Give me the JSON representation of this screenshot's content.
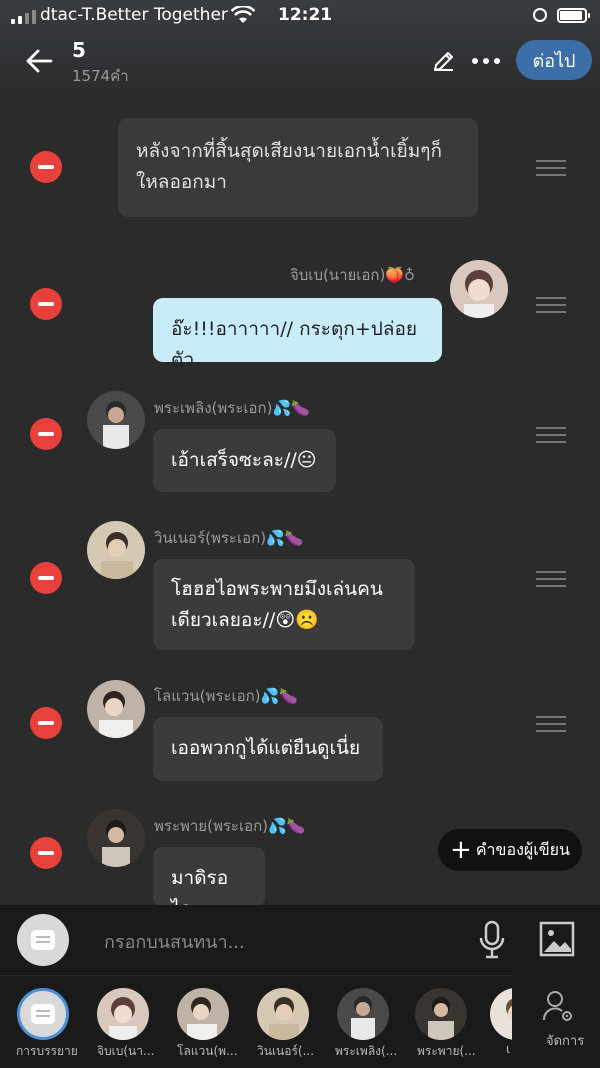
{
  "status_bar": {
    "carrier": "dtac-T.Better Together",
    "time": "12:21"
  },
  "header": {
    "title": "5",
    "subtitle": "1574คำ",
    "next_label": "ต่อไป"
  },
  "messages": [
    {
      "type": "narration",
      "line1": "หลังจากที่สิ้นสุดเสียงนายเอกน้ำเยิ้มๆก็",
      "line2": "ใหลออกมา"
    },
    {
      "type": "me",
      "speaker": "จิบเบ(นายเอก)🍑♁",
      "text": "อ๊ะ!!!อาาาาา// กระตุก+ปล่อยตัว"
    },
    {
      "type": "other",
      "speaker": "พระเพลิง(พระเอก)💦🍆",
      "text": "เอ้าเสร็จซะละ//😐"
    },
    {
      "type": "other",
      "speaker": "วินเนอร์(พระเอก)💦🍆",
      "line1": "โฮฮฮไอพระพายมึงเล่นคน",
      "line2": "เดียวเลยอะ//😲☹️"
    },
    {
      "type": "other",
      "speaker": "โลแวน(พระเอก)💦🍆",
      "text": "เออพวกกูได้แต่ยืนดูเนี่ย"
    },
    {
      "type": "other",
      "speaker": "พระพาย(พระเอก)💦🍆",
      "text": "มาดิรอไร"
    }
  ],
  "writer_note_label": "คำของผู้เขียน",
  "input": {
    "placeholder": "กรอกบนสนทนา..."
  },
  "cast": [
    {
      "label": "การบรรยาย"
    },
    {
      "label": "จิบเบ(นา..."
    },
    {
      "label": "โลแวน(พ..."
    },
    {
      "label": "วินเนอร์(..."
    },
    {
      "label": "พระเพลิง(..."
    },
    {
      "label": "พระพาย(..."
    },
    {
      "label": "ι"
    }
  ],
  "manage_label": "จัดการ",
  "colors": {
    "accent": "#3c6fa8",
    "delete": "#e8413b",
    "my_bubble": "#c9ecfb"
  }
}
